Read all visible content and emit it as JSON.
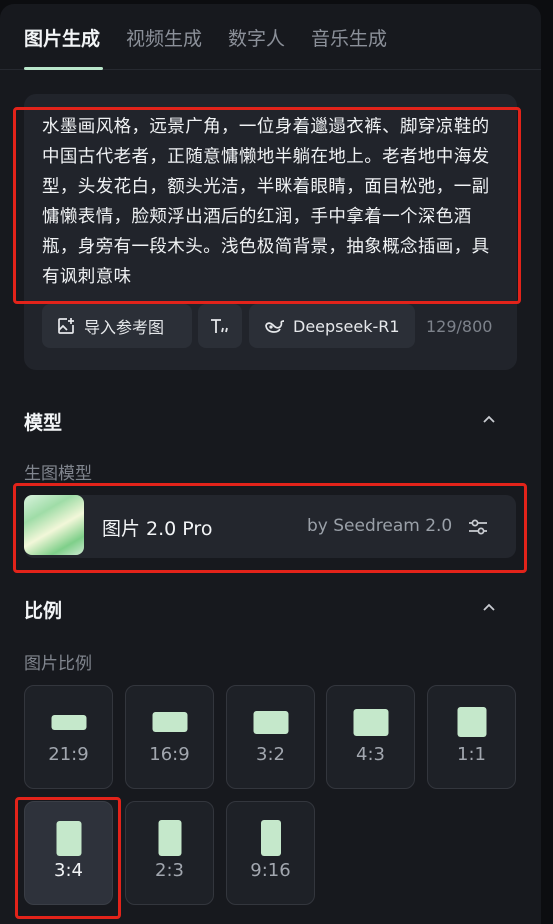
{
  "tabs": [
    {
      "label": "图片生成",
      "active": true
    },
    {
      "label": "视频生成",
      "active": false
    },
    {
      "label": "数字人",
      "active": false
    },
    {
      "label": "音乐生成",
      "active": false
    }
  ],
  "prompt": {
    "text": "水墨画风格，远景广角，一位身着邋遢衣裤、脚穿凉鞋的中国古代老者，正随意慵懒地半躺在地上。老者地中海发型，头发花白，额头光洁，半眯着眼睛，面目松弛，一副慵懒表情，脸颊浮出酒后的红润，手中拿着一个深色酒瓶，身旁有一段木头。浅色极简背景，抽象概念插画，具有讽刺意味",
    "import_reference_label": "导入参考图",
    "llm_label": "Deepseek-R1",
    "char_count": "129/800"
  },
  "model_section": {
    "title": "模型",
    "subtitle": "生图模型",
    "model_name": "图片 2.0 Pro",
    "model_by": "by Seedream 2.0"
  },
  "ratio_section": {
    "title": "比例",
    "subtitle": "图片比例",
    "options": [
      {
        "label": "21:9",
        "selected": false
      },
      {
        "label": "16:9",
        "selected": false
      },
      {
        "label": "3:2",
        "selected": false
      },
      {
        "label": "4:3",
        "selected": false
      },
      {
        "label": "1:1",
        "selected": false
      },
      {
        "label": "3:4",
        "selected": true
      },
      {
        "label": "2:3",
        "selected": false
      },
      {
        "label": "9:16",
        "selected": false
      }
    ]
  },
  "colors": {
    "accent": "#b9e6cb",
    "highlight_box": "#e2231a",
    "panel_bg": "#17191e"
  },
  "icons": [
    "image-plus-icon",
    "text-format-icon",
    "deepseek-whale-icon",
    "chevron-up-icon",
    "sliders-icon"
  ]
}
